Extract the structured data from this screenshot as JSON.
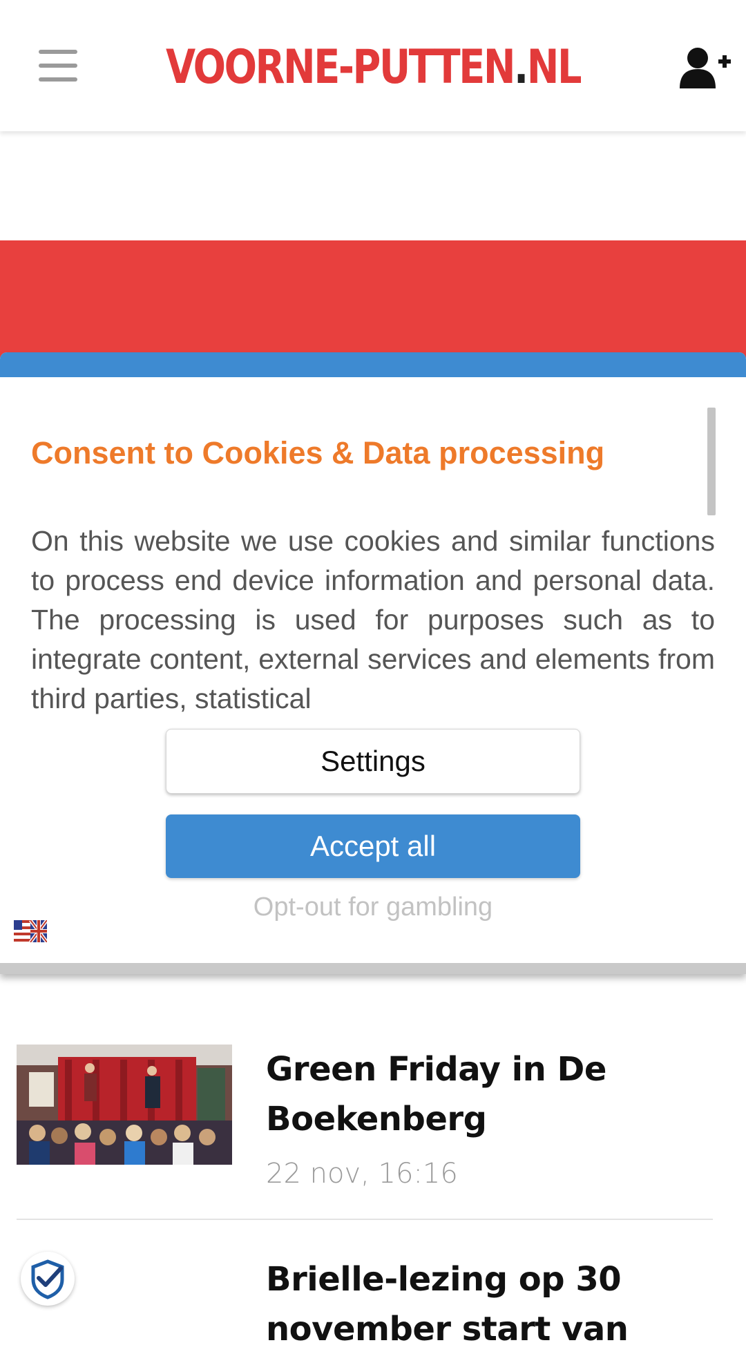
{
  "header": {
    "logo_main": "VOORNE-PUTTEN",
    "logo_dot": ".",
    "logo_tld": "NL",
    "menu_icon": "hamburger-icon",
    "account_icon": "user-plus-icon"
  },
  "consent": {
    "title": "Consent to Cookies & Data processing",
    "text": "On this website we use cookies and similar functions to process end device information and personal data. The processing is used for purposes such as to integrate content, external services and elements from third parties, statistical",
    "settings_label": "Settings",
    "accept_label": "Accept all",
    "optout_label": "Opt-out for gambling",
    "language_icon": "us-uk-flag-icon"
  },
  "articles": [
    {
      "title": "Green Friday in De Boekenberg",
      "time": "22 nov, 16:16"
    },
    {
      "title": "Brielle-lezing op 30 november start van",
      "time": ""
    }
  ],
  "colors": {
    "brand_red": "#e23a3a",
    "band_red": "#e8403e",
    "consent_blue": "#3e8bd1",
    "consent_title_orange": "#ee7a2a"
  }
}
